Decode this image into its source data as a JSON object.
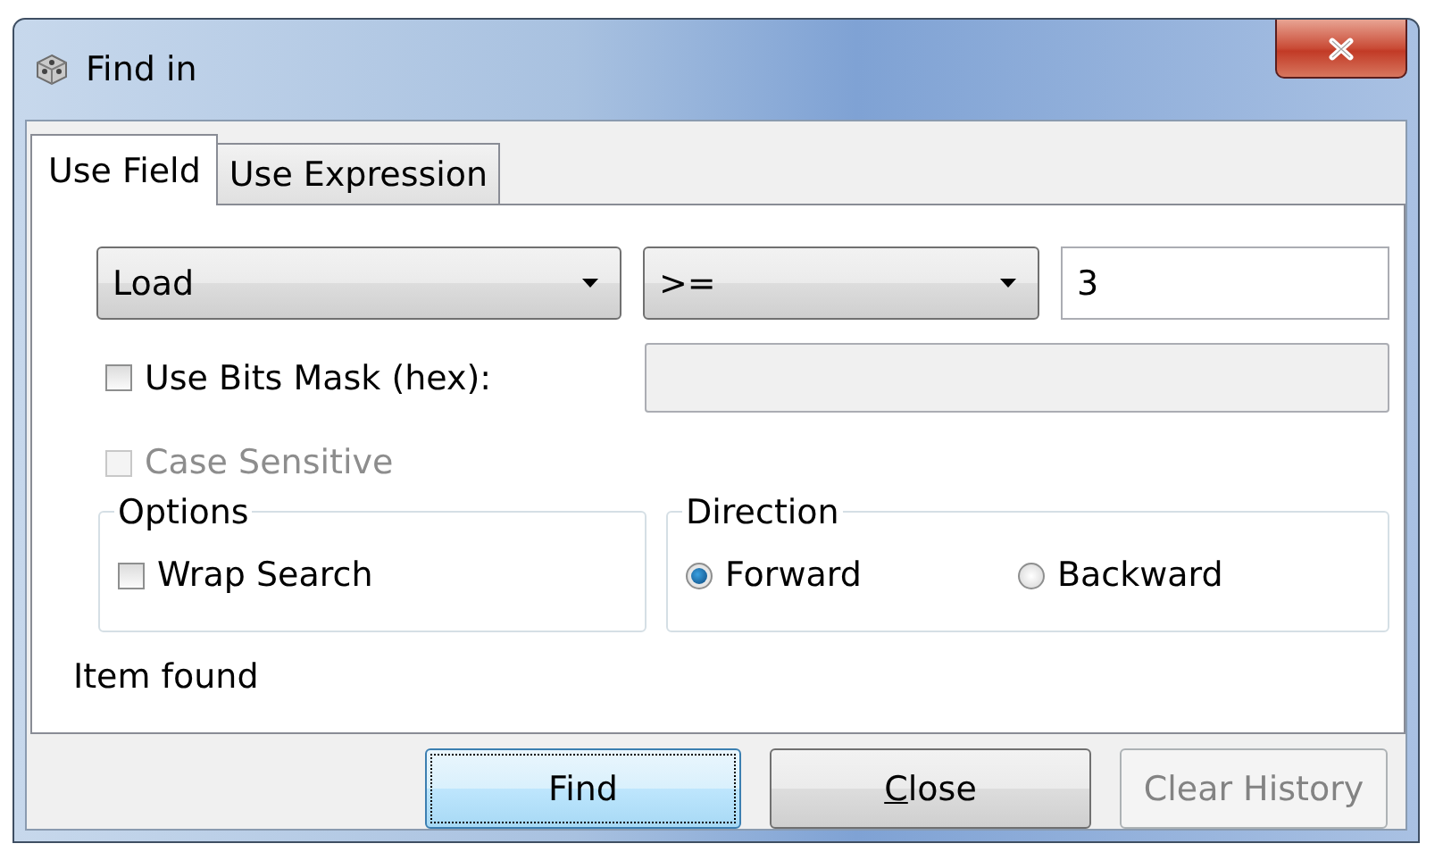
{
  "window": {
    "title": "Find in"
  },
  "tabs": [
    {
      "label": "Use Field",
      "selected": true
    },
    {
      "label": "Use Expression",
      "selected": false
    }
  ],
  "field_dropdown": {
    "value": "Load"
  },
  "operator_dropdown": {
    "value": ">="
  },
  "value_field": {
    "value": "3"
  },
  "bits_mask": {
    "label": "Use Bits Mask (hex):",
    "checked": false,
    "field_disabled": true
  },
  "case_sensitive": {
    "label": "Case Sensitive",
    "checked": false,
    "disabled": true
  },
  "options_group": {
    "title": "Options",
    "items": [
      {
        "label": "Wrap Search",
        "checked": false
      }
    ]
  },
  "direction_group": {
    "title": "Direction",
    "items": [
      {
        "label": "Forward",
        "selected": true
      },
      {
        "label": "Backward",
        "selected": false
      }
    ]
  },
  "status": "Item found",
  "buttons": [
    {
      "label": "Find",
      "kind": "default",
      "disabled": false,
      "underline_first": false
    },
    {
      "label": "Close",
      "kind": "normal",
      "disabled": false,
      "underline_first": true
    },
    {
      "label": "Clear History",
      "kind": "normal",
      "disabled": true,
      "underline_first": false
    }
  ]
}
